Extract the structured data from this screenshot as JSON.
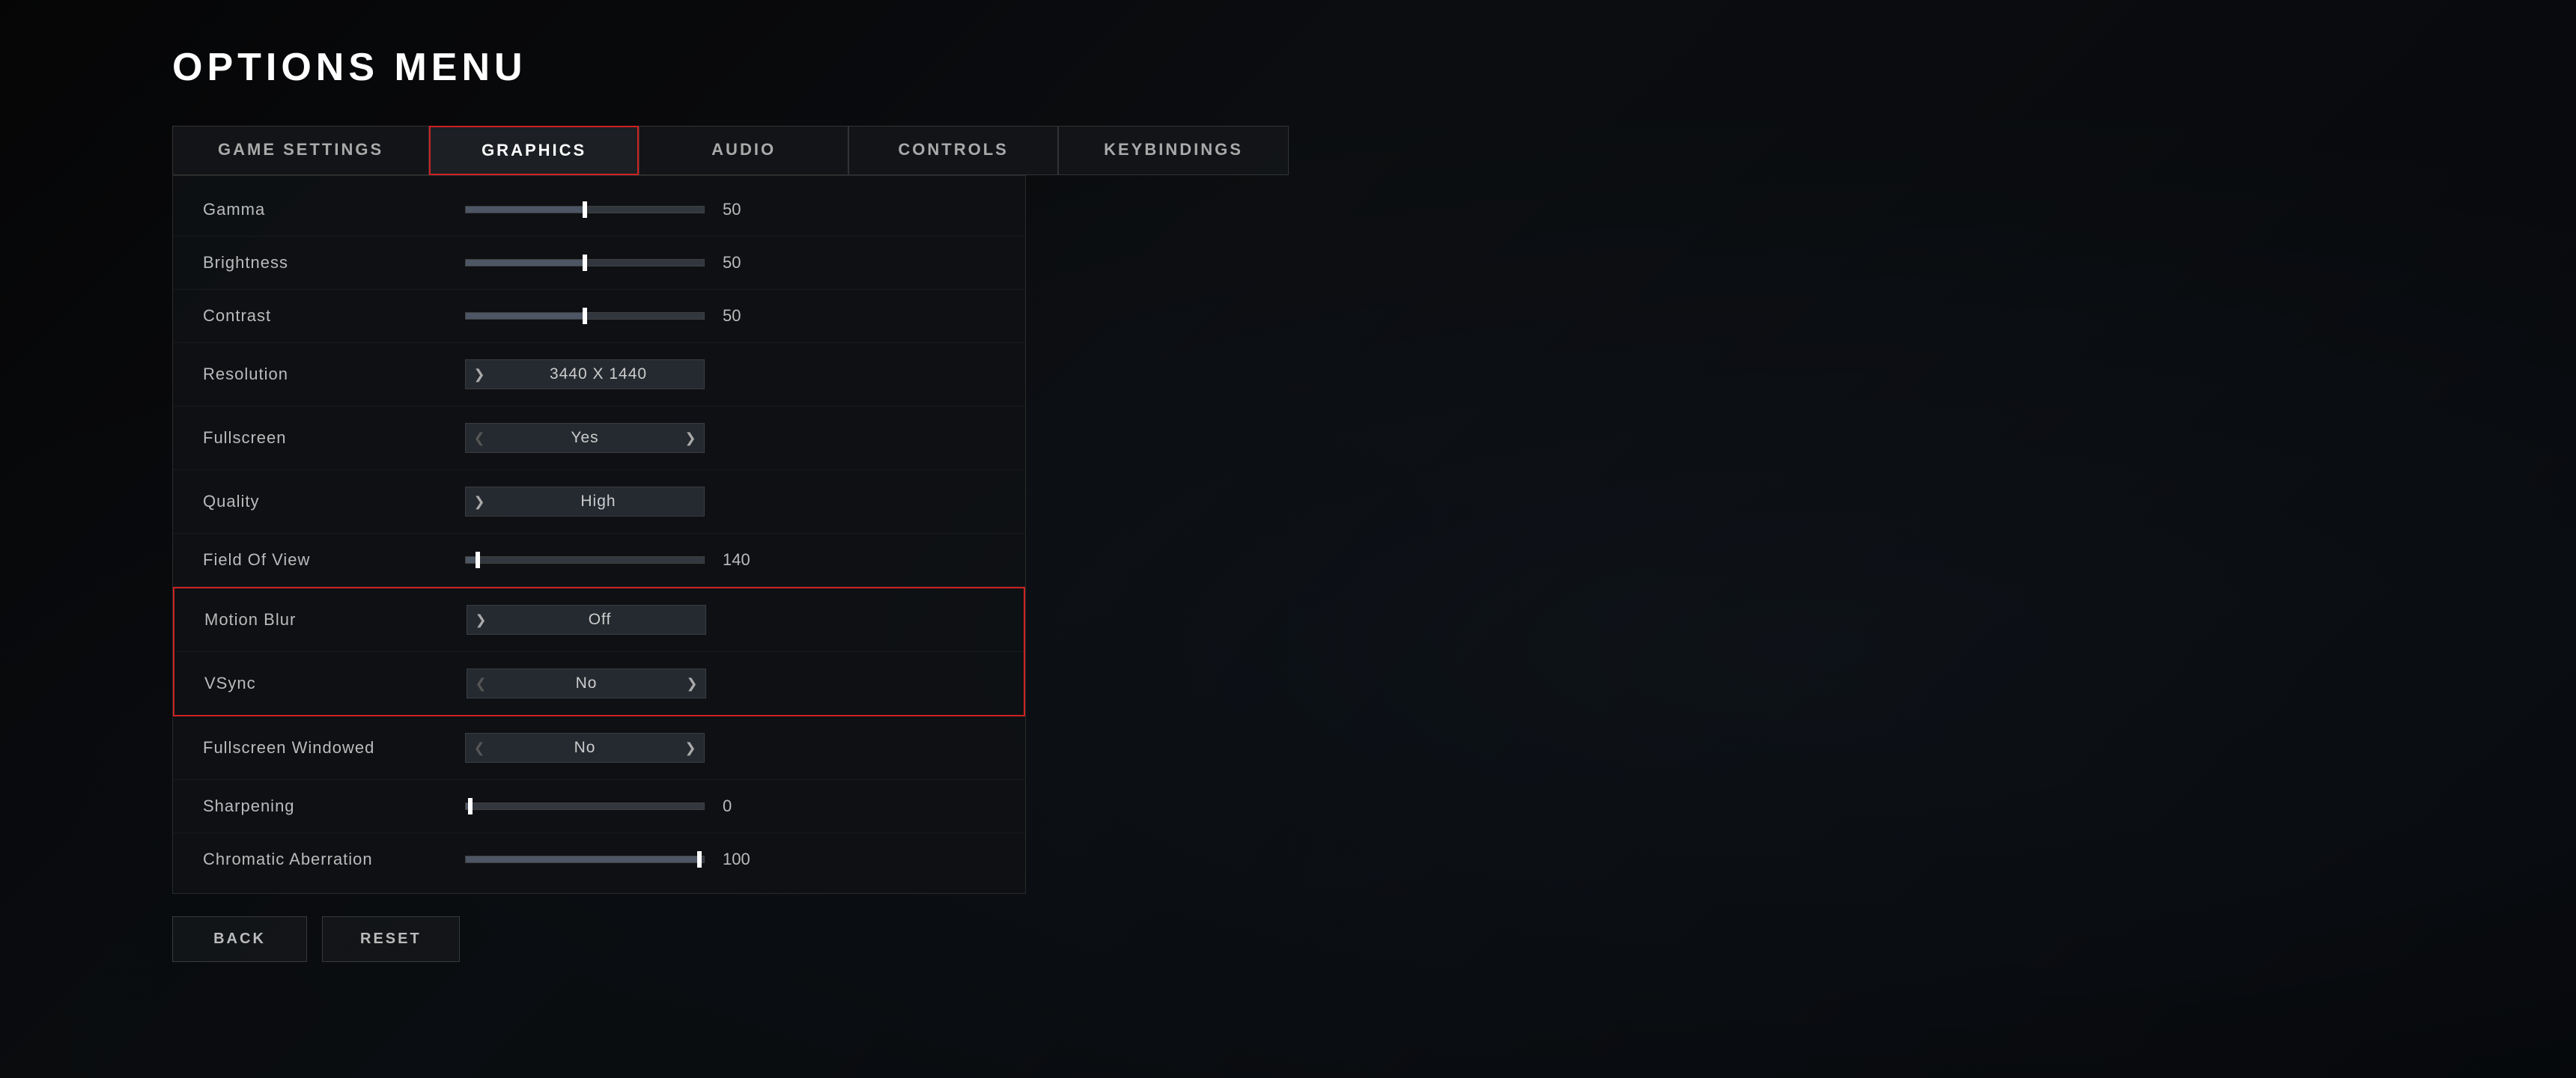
{
  "page": {
    "title": "OPTIONS MENU"
  },
  "tabs": [
    {
      "id": "game-settings",
      "label": "GAME SETTINGS",
      "active": false
    },
    {
      "id": "graphics",
      "label": "GRAPHICS",
      "active": true
    },
    {
      "id": "audio",
      "label": "AUDIO",
      "active": false
    },
    {
      "id": "controls",
      "label": "CONTROLS",
      "active": false
    },
    {
      "id": "keybindings",
      "label": "KEYBINDINGS",
      "active": false
    }
  ],
  "settings": [
    {
      "id": "gamma",
      "label": "Gamma",
      "type": "slider",
      "value": "50",
      "sliderPercent": 50,
      "highlighted": false
    },
    {
      "id": "brightness",
      "label": "Brightness",
      "type": "slider",
      "value": "50",
      "sliderPercent": 50,
      "highlighted": false
    },
    {
      "id": "contrast",
      "label": "Contrast",
      "type": "slider",
      "value": "50",
      "sliderPercent": 50,
      "highlighted": false
    },
    {
      "id": "resolution",
      "label": "Resolution",
      "type": "selector",
      "value": "3440 X 1440",
      "hasLeft": false,
      "hasRight": true,
      "highlighted": false
    },
    {
      "id": "fullscreen",
      "label": "Fullscreen",
      "type": "selector",
      "value": "Yes",
      "hasLeft": true,
      "hasRight": true,
      "highlighted": false
    },
    {
      "id": "quality",
      "label": "Quality",
      "type": "selector",
      "value": "High",
      "hasLeft": false,
      "hasRight": true,
      "highlighted": false
    },
    {
      "id": "field-of-view",
      "label": "Field Of View",
      "type": "slider",
      "value": "140",
      "sliderPercent": 5,
      "highlighted": false
    },
    {
      "id": "motion-blur",
      "label": "Motion Blur",
      "type": "selector",
      "value": "Off",
      "hasLeft": false,
      "hasRight": true,
      "highlighted": true,
      "groupStart": true
    },
    {
      "id": "vsync",
      "label": "VSync",
      "type": "selector",
      "value": "No",
      "hasLeft": true,
      "hasRight": true,
      "highlighted": true,
      "groupEnd": true
    },
    {
      "id": "fullscreen-windowed",
      "label": "Fullscreen Windowed",
      "type": "selector",
      "value": "No",
      "hasLeft": true,
      "hasRight": true,
      "highlighted": false
    },
    {
      "id": "sharpening",
      "label": "Sharpening",
      "type": "slider",
      "value": "0",
      "sliderPercent": 2,
      "highlighted": false
    },
    {
      "id": "chromatic-aberration",
      "label": "Chromatic Aberration",
      "type": "slider",
      "value": "100",
      "sliderPercent": 98,
      "highlighted": false
    }
  ],
  "buttons": {
    "back": "BACK",
    "reset": "RESET"
  },
  "icons": {
    "chevron_left": "❮",
    "chevron_right": "❯"
  }
}
